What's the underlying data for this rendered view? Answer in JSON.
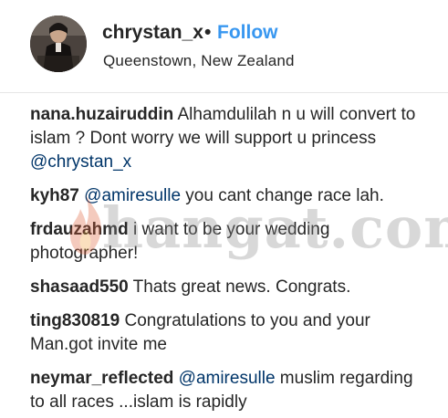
{
  "header": {
    "username": "chrystan_x",
    "separator": "•",
    "follow_label": "Follow",
    "location": "Queenstown, New Zealand"
  },
  "comments": [
    {
      "author": "nana.huzairuddin",
      "text_before": " Alhamdulilah n u will convert to islam ? Dont worry we will support u princess ",
      "mention": "@chrystan_x",
      "text_after": ""
    },
    {
      "author": "kyh87",
      "text_before": " ",
      "mention": "@amiresulle",
      "text_after": " you cant change race lah."
    },
    {
      "author": "frdauzahmd",
      "text_before": " i want to be your wedding photographer!",
      "mention": "",
      "text_after": ""
    },
    {
      "author": "shasaad550",
      "text_before": " Thats great news. Congrats.",
      "mention": "",
      "text_after": ""
    },
    {
      "author": "ting830819",
      "text_before": " Congratulations to you and your Man.got invite me",
      "mention": "",
      "text_after": ""
    },
    {
      "author": "neymar_reflected",
      "text_before": " ",
      "mention": "@amiresulle",
      "text_after": " muslim regarding to all races ...islam is rapidly"
    }
  ],
  "watermark": {
    "text": "hangat.com"
  },
  "colors": {
    "text": "#262626",
    "follow": "#3897f0",
    "mention": "#003569",
    "divider": "#e6e6e6"
  }
}
